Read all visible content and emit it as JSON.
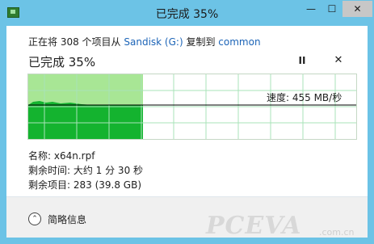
{
  "window": {
    "title": "已完成 35%",
    "controls": {
      "minimize": "—",
      "maximize": "☐",
      "close": "✕"
    }
  },
  "copy": {
    "prefix": "正在将 308 个项目从",
    "source": "Sandisk (G:)",
    "middle": "复制到",
    "destination": "common"
  },
  "status": "已完成 35%",
  "buttons": {
    "pause": "II",
    "stop": "✕"
  },
  "graph": {
    "progress": 0.35,
    "speed_text": "速度: 455 MB/秒",
    "colors": {
      "fill_light": "#a8e695",
      "fill_dark": "#14b32f",
      "grid": "#a8e3b8",
      "speed_line": "#000000"
    }
  },
  "details": {
    "name": "名称: x64n.rpf",
    "time_remaining": "剩余时间: 大约 1 分 30 秒",
    "items_remaining": "剩余项目: 283 (39.8 GB)"
  },
  "footer": {
    "expand_icon": "⌃",
    "label": "简略信息"
  },
  "watermark": {
    "logo": "PCEVA",
    "domain": ".com.cn"
  }
}
